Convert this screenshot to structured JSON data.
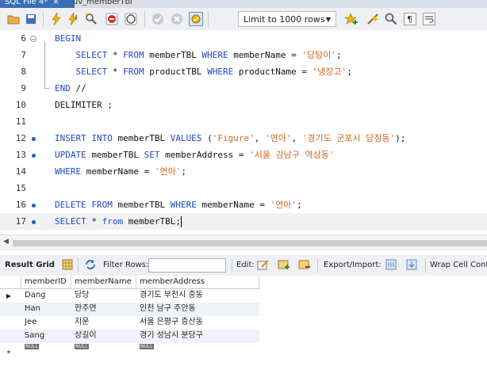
{
  "tabs": [
    {
      "label": "SQL File 4*",
      "close": "×"
    },
    {
      "label": "uv_memberTbl"
    }
  ],
  "toolbar": {
    "limit_label": "Limit to 1000 rows"
  },
  "editor": {
    "lines": [
      {
        "num": "6",
        "marker": "fold",
        "parts": [
          {
            "t": "kw",
            "v": "BEGIN"
          }
        ]
      },
      {
        "num": "7",
        "marker": "",
        "parts": [
          {
            "t": "pl",
            "v": "    "
          },
          {
            "t": "kw",
            "v": "SELECT"
          },
          {
            "t": "pl",
            "v": " * "
          },
          {
            "t": "kw",
            "v": "FROM"
          },
          {
            "t": "pl",
            "v": " memberTBL "
          },
          {
            "t": "kw",
            "v": "WHERE"
          },
          {
            "t": "pl",
            "v": " memberName = "
          },
          {
            "t": "str",
            "v": "'당탕이'"
          },
          {
            "t": "pl",
            "v": ";"
          }
        ]
      },
      {
        "num": "8",
        "marker": "",
        "parts": [
          {
            "t": "pl",
            "v": "    "
          },
          {
            "t": "kw",
            "v": "SELECT"
          },
          {
            "t": "pl",
            "v": " * "
          },
          {
            "t": "kw",
            "v": "FROM"
          },
          {
            "t": "pl",
            "v": " productTBL "
          },
          {
            "t": "kw",
            "v": "WHERE"
          },
          {
            "t": "pl",
            "v": " productName = "
          },
          {
            "t": "str",
            "v": "'냉장고'"
          },
          {
            "t": "pl",
            "v": ";"
          }
        ]
      },
      {
        "num": "9",
        "marker": "",
        "parts": [
          {
            "t": "kw",
            "v": "END"
          },
          {
            "t": "pl",
            "v": " //"
          }
        ]
      },
      {
        "num": "10",
        "marker": "",
        "parts": [
          {
            "t": "pl",
            "v": "DELIMITER ;"
          }
        ]
      },
      {
        "num": "11",
        "marker": "",
        "parts": []
      },
      {
        "num": "12",
        "marker": "dot",
        "parts": [
          {
            "t": "kw",
            "v": "INSERT INTO"
          },
          {
            "t": "pl",
            "v": " memberTBL "
          },
          {
            "t": "kw",
            "v": "VALUES"
          },
          {
            "t": "pl",
            "v": " ("
          },
          {
            "t": "str",
            "v": "'Figure'"
          },
          {
            "t": "pl",
            "v": ", "
          },
          {
            "t": "str",
            "v": "'연아'"
          },
          {
            "t": "pl",
            "v": ", "
          },
          {
            "t": "str",
            "v": "'경기도 군포시 당정동'"
          },
          {
            "t": "pl",
            "v": ");"
          }
        ]
      },
      {
        "num": "13",
        "marker": "dot",
        "parts": [
          {
            "t": "kw",
            "v": "UPDATE"
          },
          {
            "t": "pl",
            "v": " memberTBL "
          },
          {
            "t": "kw",
            "v": "SET"
          },
          {
            "t": "pl",
            "v": " memberAddress = "
          },
          {
            "t": "str",
            "v": "'서울 강남구 역삼동'"
          }
        ]
      },
      {
        "num": "14",
        "marker": "",
        "parts": [
          {
            "t": "kw",
            "v": "WHERE"
          },
          {
            "t": "pl",
            "v": " memberName = "
          },
          {
            "t": "str",
            "v": "'연아'"
          },
          {
            "t": "pl",
            "v": ";"
          }
        ]
      },
      {
        "num": "15",
        "marker": "",
        "parts": []
      },
      {
        "num": "16",
        "marker": "dot",
        "parts": [
          {
            "t": "kw",
            "v": "DELETE FROM"
          },
          {
            "t": "pl",
            "v": " memberTBL "
          },
          {
            "t": "kw",
            "v": "WHERE"
          },
          {
            "t": "pl",
            "v": " memberName = "
          },
          {
            "t": "str",
            "v": "'연아'"
          },
          {
            "t": "pl",
            "v": ";"
          }
        ]
      },
      {
        "num": "17",
        "marker": "dot",
        "current": true,
        "parts": [
          {
            "t": "kw",
            "v": "SELECT"
          },
          {
            "t": "pl",
            "v": " * "
          },
          {
            "t": "kw",
            "v": "from"
          },
          {
            "t": "pl",
            "v": " memberTBL;"
          }
        ]
      }
    ]
  },
  "result_toolbar": {
    "result_grid": "Result Grid",
    "filter_rows": "Filter Rows:",
    "edit": "Edit:",
    "export_import": "Export/Import:",
    "wrap": "Wrap Cell Conte"
  },
  "grid": {
    "columns": [
      "memberID",
      "memberName",
      "memberAddress"
    ],
    "rows": [
      [
        "Dang",
        "당당",
        "경기도 부천시 중동"
      ],
      [
        "Han",
        "한주연",
        "인천 남구 주안동"
      ],
      [
        "Jee",
        "지운",
        "서울 은평구 증산동"
      ],
      [
        "Sang",
        "상길이",
        "경기 성남시 분당구"
      ]
    ],
    "null_label": "NULL",
    "new_row_marker": "*"
  }
}
